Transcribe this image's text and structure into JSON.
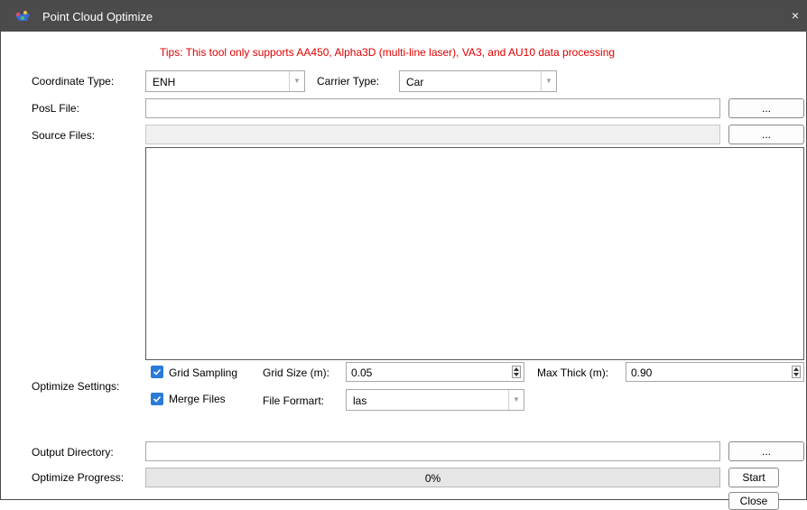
{
  "window": {
    "title": "Point Cloud Optimize",
    "close_glyph": "×",
    "icons": {
      "app": "app-icon",
      "close": "close-icon"
    }
  },
  "tip": "Tips: This tool only supports AA450, Alpha3D (multi-line laser), VA3, and AU10 data processing",
  "coordinate": {
    "label": "Coordinate Type:",
    "value": "ENH"
  },
  "carrier": {
    "label": "Carrier Type:",
    "value": "Car"
  },
  "posl": {
    "label": "PosL File:",
    "value": "",
    "browse_label": "..."
  },
  "source": {
    "label": "Source Files:",
    "value": "",
    "browse_label": "...",
    "files": []
  },
  "optimize": {
    "label": "Optimize Settings:",
    "grid_sampling": {
      "label": "Grid Sampling",
      "checked": true
    },
    "grid_size": {
      "label": "Grid Size (m):",
      "value": "0.05"
    },
    "max_thick": {
      "label": "Max Thick (m):",
      "value": "0.90"
    },
    "merge_files": {
      "label": "Merge Files",
      "checked": true
    },
    "file_format": {
      "label": "File Formart:",
      "value": "las"
    }
  },
  "output": {
    "label": "Output Directory:",
    "value": "",
    "browse_label": "..."
  },
  "progress": {
    "label": "Optimize Progress:",
    "value": 0,
    "text": "0%"
  },
  "buttons": {
    "start": "Start",
    "close": "Close"
  },
  "colors": {
    "tip": "#e00000",
    "checkbox": "#2a7ad8",
    "titlebar": "#4b4b4b"
  }
}
